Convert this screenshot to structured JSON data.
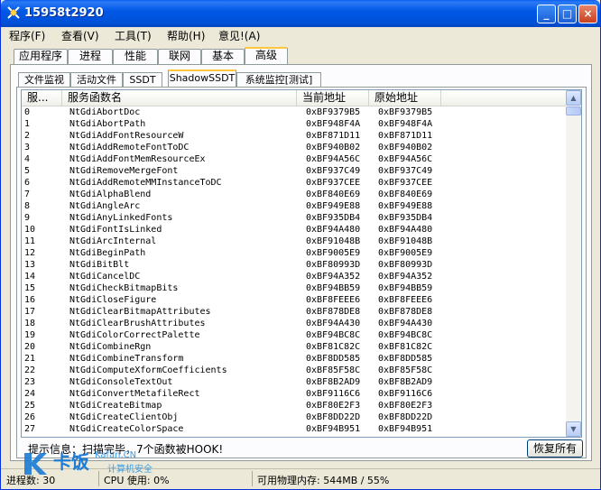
{
  "window": {
    "title": "15958t2920"
  },
  "title_buttons": {
    "minimize": "_",
    "maximize": "□",
    "close": "×"
  },
  "menu": [
    "程序(F)",
    "查看(V)",
    "工具(T)",
    "帮助(H)",
    "意见!(A)"
  ],
  "tabs": [
    "应用程序",
    "进程",
    "性能",
    "联网",
    "基本",
    "高级"
  ],
  "active_tab": "高级",
  "subtabs": [
    "文件监视",
    "活动文件",
    "SSDT",
    "ShadowSSDT",
    "系统监控[测试]"
  ],
  "active_subtab": "ShadowSSDT",
  "columns": [
    "服...",
    "服务函数名",
    "当前地址",
    "原始地址"
  ],
  "rows": [
    [
      "0",
      "NtGdiAbortDoc",
      "0xBF9379B5",
      "0xBF9379B5"
    ],
    [
      "1",
      "NtGdiAbortPath",
      "0xBF948F4A",
      "0xBF948F4A"
    ],
    [
      "2",
      "NtGdiAddFontResourceW",
      "0xBF871D11",
      "0xBF871D11"
    ],
    [
      "3",
      "NtGdiAddRemoteFontToDC",
      "0xBF940B02",
      "0xBF940B02"
    ],
    [
      "4",
      "NtGdiAddFontMemResourceEx",
      "0xBF94A56C",
      "0xBF94A56C"
    ],
    [
      "5",
      "NtGdiRemoveMergeFont",
      "0xBF937C49",
      "0xBF937C49"
    ],
    [
      "6",
      "NtGdiAddRemoteMMInstanceToDC",
      "0xBF937CEE",
      "0xBF937CEE"
    ],
    [
      "7",
      "NtGdiAlphaBlend",
      "0xBF840E69",
      "0xBF840E69"
    ],
    [
      "8",
      "NtGdiAngleArc",
      "0xBF949E88",
      "0xBF949E88"
    ],
    [
      "9",
      "NtGdiAnyLinkedFonts",
      "0xBF935DB4",
      "0xBF935DB4"
    ],
    [
      "10",
      "NtGdiFontIsLinked",
      "0xBF94A480",
      "0xBF94A480"
    ],
    [
      "11",
      "NtGdiArcInternal",
      "0xBF91048B",
      "0xBF91048B"
    ],
    [
      "12",
      "NtGdiBeginPath",
      "0xBF9005E9",
      "0xBF9005E9"
    ],
    [
      "13",
      "NtGdiBitBlt",
      "0xBF80993D",
      "0xBF80993D"
    ],
    [
      "14",
      "NtGdiCancelDC",
      "0xBF94A352",
      "0xBF94A352"
    ],
    [
      "15",
      "NtGdiCheckBitmapBits",
      "0xBF94BB59",
      "0xBF94BB59"
    ],
    [
      "16",
      "NtGdiCloseFigure",
      "0xBF8FEEE6",
      "0xBF8FEEE6"
    ],
    [
      "17",
      "NtGdiClearBitmapAttributes",
      "0xBF878DE8",
      "0xBF878DE8"
    ],
    [
      "18",
      "NtGdiClearBrushAttributes",
      "0xBF94A430",
      "0xBF94A430"
    ],
    [
      "19",
      "NtGdiColorCorrectPalette",
      "0xBF94BC8C",
      "0xBF94BC8C"
    ],
    [
      "20",
      "NtGdiCombineRgn",
      "0xBF81C82C",
      "0xBF81C82C"
    ],
    [
      "21",
      "NtGdiCombineTransform",
      "0xBF8DD585",
      "0xBF8DD585"
    ],
    [
      "22",
      "NtGdiComputeXformCoefficients",
      "0xBF85F58C",
      "0xBF85F58C"
    ],
    [
      "23",
      "NtGdiConsoleTextOut",
      "0xBF8B2AD9",
      "0xBF8B2AD9"
    ],
    [
      "24",
      "NtGdiConvertMetafileRect",
      "0xBF9116C6",
      "0xBF9116C6"
    ],
    [
      "25",
      "NtGdiCreateBitmap",
      "0xBF80E2F3",
      "0xBF80E2F3"
    ],
    [
      "26",
      "NtGdiCreateClientObj",
      "0xBF8DD22D",
      "0xBF8DD22D"
    ],
    [
      "27",
      "NtGdiCreateColorSpace",
      "0xBF94B951",
      "0xBF94B951"
    ]
  ],
  "hint": "提示信息：扫描完毕，7个函数被HOOK!",
  "restore_button": "恢复所有",
  "status": {
    "processes": "进程数: 30",
    "cpu": "CPU 使用: 0%",
    "memory": "可用物理内存: 544MB / 55%"
  },
  "watermark": {
    "name": "卡饭",
    "line1": "Kafan.CN",
    "line2": "计算机安全"
  },
  "colors": {
    "title_bar": "#0058e6",
    "tab_highlight": "#ffc83c"
  }
}
